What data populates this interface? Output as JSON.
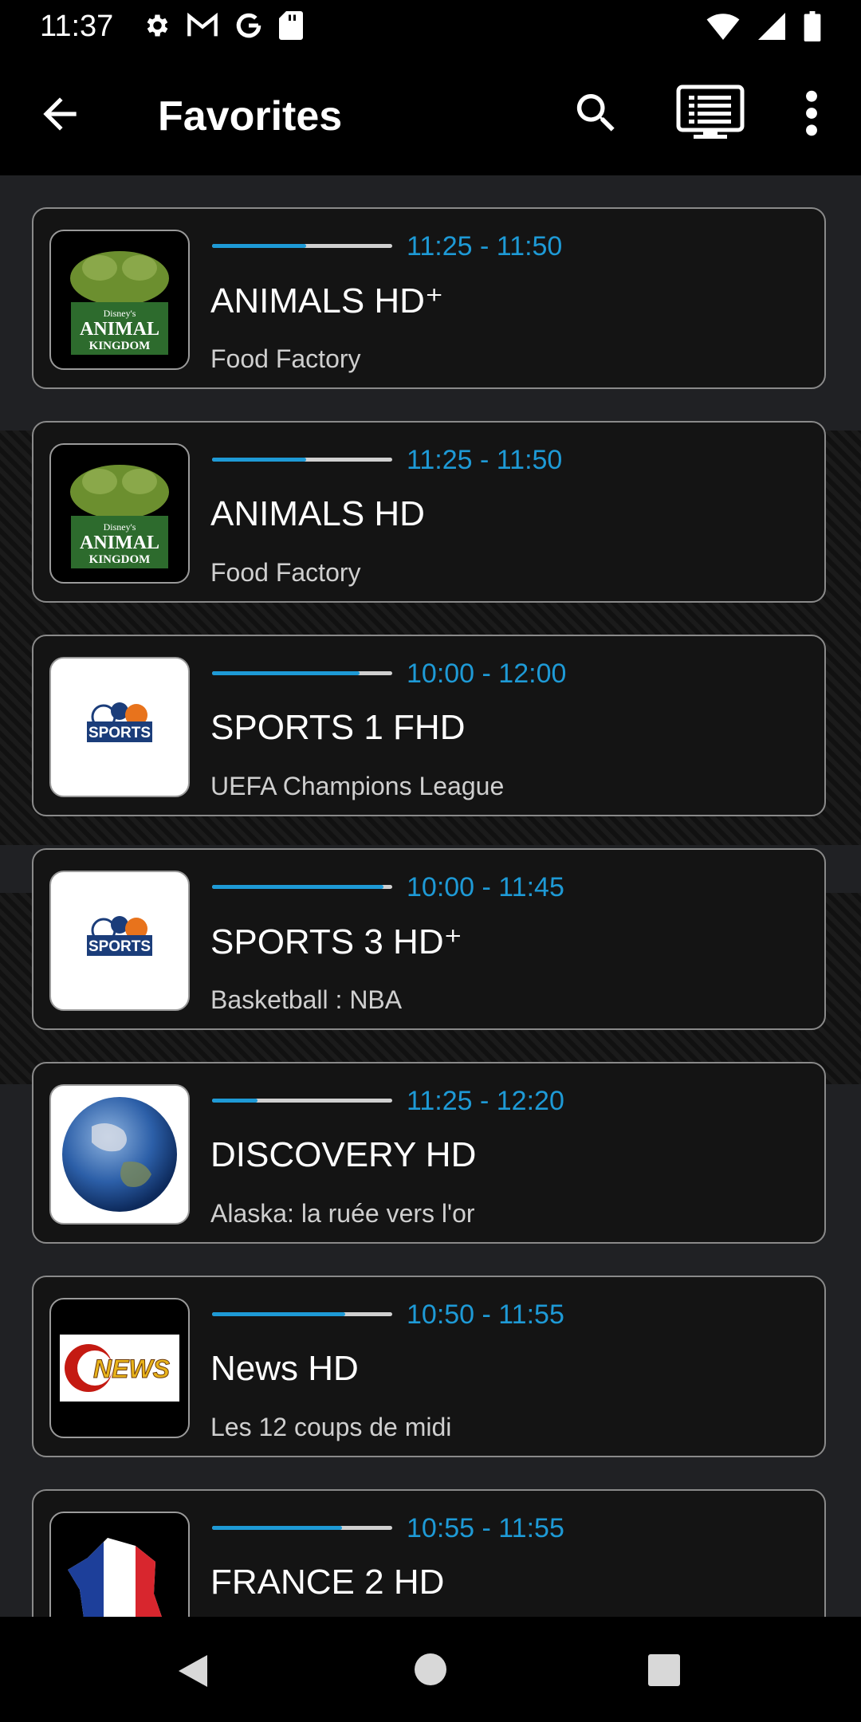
{
  "status_bar": {
    "time": "11:37",
    "left_icons": [
      "gear-icon",
      "gmail-icon",
      "google-icon",
      "sd-card-icon"
    ],
    "right_icons": [
      "wifi-icon",
      "signal-icon",
      "battery-icon"
    ]
  },
  "app_bar": {
    "title": "Favorites",
    "actions": [
      "search-icon",
      "epg-icon",
      "more-vert-icon"
    ]
  },
  "accent_color": "#1e9ad6",
  "channels": [
    {
      "name": "ANIMALS HD⁺",
      "time": "11:25 - 11:50",
      "show": "Food Factory",
      "progress": 0.52,
      "logo": "animal-kingdom-logo",
      "logo_text": [
        "Disney's",
        "ANIMAL",
        "KINGDOM"
      ]
    },
    {
      "name": "ANIMALS HD",
      "time": "11:25 - 11:50",
      "show": "Food Factory",
      "progress": 0.52,
      "logo": "animal-kingdom-logo",
      "logo_text": [
        "Disney's",
        "ANIMAL",
        "KINGDOM"
      ]
    },
    {
      "name": "SPORTS 1 FHD",
      "time": "10:00 - 12:00",
      "show": "UEFA Champions League",
      "progress": 0.82,
      "logo": "sports-logo",
      "logo_text": [
        "SPORTS"
      ]
    },
    {
      "name": "SPORTS 3 HD⁺",
      "time": "10:00 - 11:45",
      "show": "Basketball : NBA",
      "progress": 0.95,
      "logo": "sports-logo",
      "logo_text": [
        "SPORTS"
      ]
    },
    {
      "name": "DISCOVERY HD",
      "time": "11:25 - 12:20",
      "show": "Alaska: la ruée vers l'or",
      "progress": 0.25,
      "logo": "globe-logo",
      "logo_text": []
    },
    {
      "name": "News HD",
      "time": "10:50 - 11:55",
      "show": "Les 12 coups de midi",
      "progress": 0.74,
      "logo": "news-logo",
      "logo_text": [
        "NEWS"
      ]
    },
    {
      "name": "FRANCE 2 HD",
      "time": "10:55 - 11:55",
      "show": "",
      "progress": 0.72,
      "logo": "france-map-logo",
      "logo_text": []
    }
  ],
  "nav_bar": [
    "nav-back-icon",
    "nav-home-icon",
    "nav-recents-icon"
  ]
}
